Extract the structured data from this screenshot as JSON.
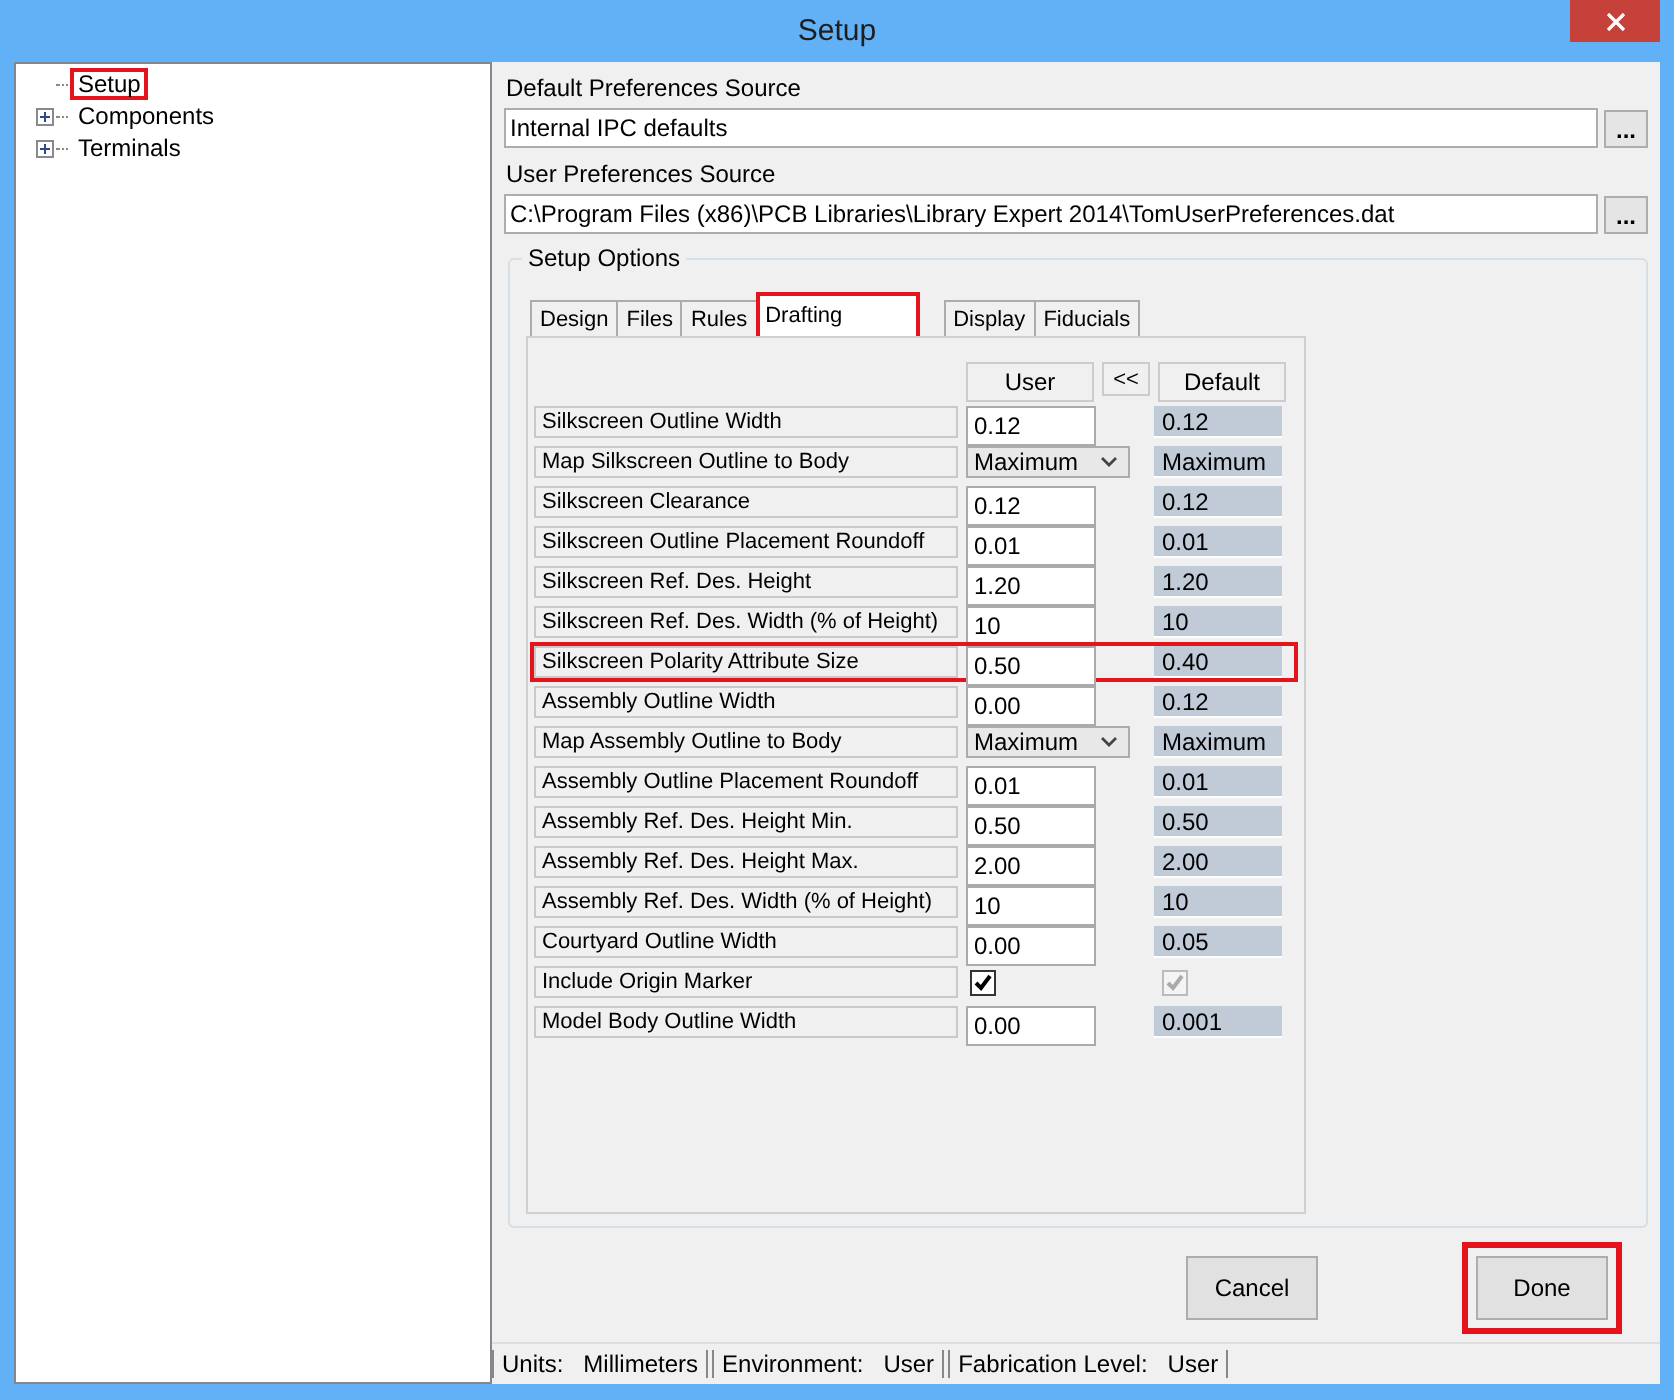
{
  "window": {
    "title": "Setup"
  },
  "tree": [
    {
      "label": "Setup",
      "expandable": false,
      "highlighted": true
    },
    {
      "label": "Components",
      "expandable": true,
      "highlighted": false
    },
    {
      "label": "Terminals",
      "expandable": true,
      "highlighted": false
    }
  ],
  "default_source": {
    "label": "Default Preferences Source",
    "value": "Internal IPC defaults",
    "browse": "..."
  },
  "user_source": {
    "label": "User Preferences Source",
    "value": "C:\\Program Files (x86)\\PCB Libraries\\Library Expert 2014\\TomUserPreferences.dat",
    "browse": "..."
  },
  "setup_options": {
    "title": "Setup Options",
    "tabs": [
      {
        "label": "Design",
        "selected": false
      },
      {
        "label": "Files",
        "selected": false
      },
      {
        "label": "Rules",
        "selected": false
      },
      {
        "label": "Drafting",
        "selected": true
      },
      {
        "label": "Display",
        "selected": false
      },
      {
        "label": "Fiducials",
        "selected": false
      }
    ],
    "columns": {
      "user": "User",
      "copy": "<<",
      "default": "Default"
    },
    "rows": [
      {
        "kind": "text",
        "label": "Silkscreen Outline Width",
        "user": "0.12",
        "default": "0.12",
        "highlighted": false
      },
      {
        "kind": "select",
        "label": "Map Silkscreen Outline to Body",
        "user": "Maximum",
        "default": "Maximum",
        "highlighted": false
      },
      {
        "kind": "text",
        "label": "Silkscreen Clearance",
        "user": "0.12",
        "default": "0.12",
        "highlighted": false
      },
      {
        "kind": "text",
        "label": "Silkscreen Outline Placement Roundoff",
        "user": "0.01",
        "default": "0.01",
        "highlighted": false
      },
      {
        "kind": "text",
        "label": "Silkscreen Ref. Des. Height",
        "user": "1.20",
        "default": "1.20",
        "highlighted": false
      },
      {
        "kind": "text",
        "label": "Silkscreen Ref. Des. Width (% of Height)",
        "user": "10",
        "default": "10",
        "highlighted": false
      },
      {
        "kind": "text",
        "label": "Silkscreen Polarity Attribute Size",
        "user": "0.50",
        "default": "0.40",
        "highlighted": true
      },
      {
        "kind": "text",
        "label": "Assembly Outline Width",
        "user": "0.00",
        "default": "0.12",
        "highlighted": false
      },
      {
        "kind": "select",
        "label": "Map Assembly Outline to Body",
        "user": "Maximum",
        "default": "Maximum",
        "highlighted": false
      },
      {
        "kind": "text",
        "label": "Assembly Outline Placement Roundoff",
        "user": "0.01",
        "default": "0.01",
        "highlighted": false
      },
      {
        "kind": "text",
        "label": "Assembly Ref. Des.  Height Min.",
        "user": "0.50",
        "default": "0.50",
        "highlighted": false
      },
      {
        "kind": "text",
        "label": "Assembly Ref. Des. Height Max.",
        "user": "2.00",
        "default": "2.00",
        "highlighted": false
      },
      {
        "kind": "text",
        "label": "Assembly Ref. Des. Width (% of Height)",
        "user": "10",
        "default": "10",
        "highlighted": false
      },
      {
        "kind": "text",
        "label": "Courtyard Outline Width",
        "user": "0.00",
        "default": "0.05",
        "highlighted": false
      },
      {
        "kind": "checkbox",
        "label": "Include Origin Marker",
        "user_checked": true,
        "default_checked": true,
        "highlighted": false
      },
      {
        "kind": "text",
        "label": "Model Body Outline Width",
        "user": "0.00",
        "default": "0.001",
        "highlighted": false
      }
    ]
  },
  "buttons": [
    {
      "label": "Cancel",
      "highlighted": false
    },
    {
      "label": "Done",
      "highlighted": true
    }
  ],
  "status_bar": [
    {
      "label": "Units:",
      "value": "Millimeters"
    },
    {
      "label": "Environment:",
      "value": "User"
    },
    {
      "label": "Fabrication Level:",
      "value": "User"
    }
  ]
}
